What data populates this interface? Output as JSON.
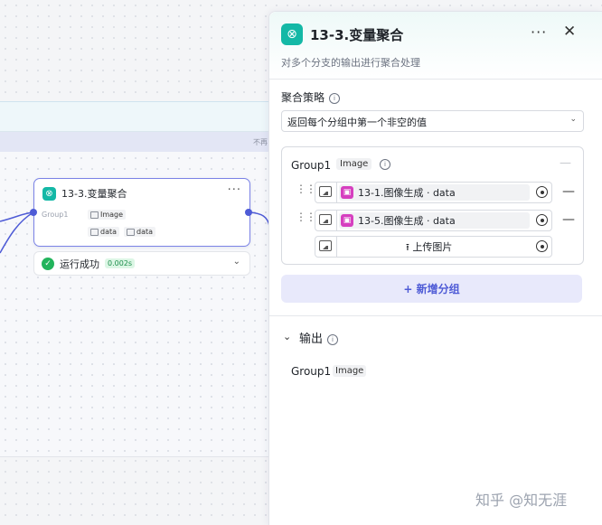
{
  "canvas": {
    "band_label": "不再",
    "node": {
      "title": "13-3.变量聚合",
      "more_icon": "···",
      "group_label": "Group1",
      "group_type": "Image",
      "var1": "data",
      "var2": "data"
    },
    "status": {
      "text": "运行成功",
      "time": "0.002s"
    }
  },
  "panel": {
    "title": "13-3.变量聚合",
    "more_icon": "···",
    "close_icon": "✕",
    "description": "对多个分支的输出进行聚合处理",
    "strategy": {
      "label": "聚合策略",
      "value": "返回每个分组中第一个非空的值"
    },
    "group": {
      "name": "Group1",
      "type": "Image",
      "variables": [
        {
          "ref": "13-1.图像生成 · data"
        },
        {
          "ref": "13-5.图像生成 · data"
        }
      ],
      "upload_label": "上传图片"
    },
    "add_group_label": "+ 新增分组",
    "output": {
      "title": "输出",
      "name": "Group1",
      "type": "Image"
    }
  },
  "watermark": "知乎 @知无涯",
  "colors": {
    "accent": "#4e5bd6",
    "node_icon": "#14b8a6",
    "ref_icon": "#d63fbf",
    "success": "#22b45c"
  }
}
